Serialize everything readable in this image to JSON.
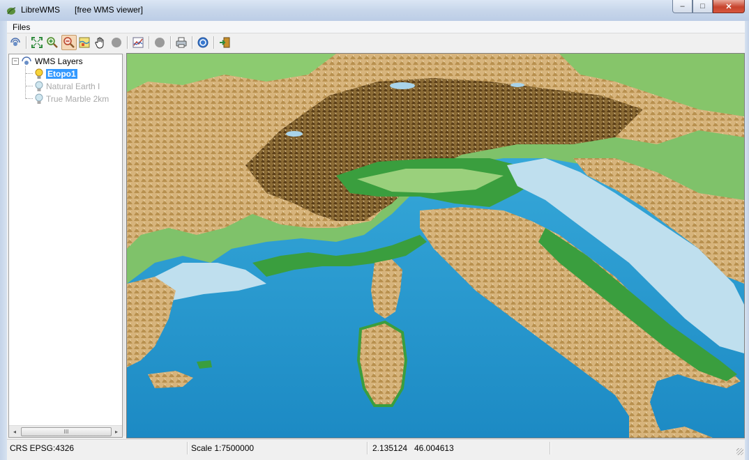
{
  "window": {
    "app_name": "LibreWMS",
    "subtitle": "[free WMS viewer]",
    "minimize_label": "–",
    "maximize_label": "□",
    "close_label": "✕"
  },
  "menu": {
    "files_label": "Files"
  },
  "toolbar": {
    "buttons": [
      "wms-connect",
      "zoom-full-extent",
      "zoom-in",
      "zoom-out",
      "zoom-layer",
      "pan",
      "stop",
      "map-style",
      "stop-2",
      "print",
      "help",
      "exit"
    ],
    "active_button": "zoom-out"
  },
  "tree": {
    "root_label": "WMS Layers",
    "expander": "−",
    "layers": [
      {
        "label": "Etopo1",
        "selected": true,
        "enabled": true
      },
      {
        "label": "Natural Earth I",
        "selected": false,
        "enabled": false
      },
      {
        "label": "True Marble 2km",
        "selected": false,
        "enabled": false
      }
    ],
    "scroll_left": "◂",
    "scroll_right": "▸",
    "scroll_thumb": "III"
  },
  "status": {
    "crs": "CRS EPSG:4326",
    "scale": "Scale 1:7500000",
    "lon": "2.135124",
    "lat": "46.004613"
  },
  "colors": {
    "sea": "#2fa7d8",
    "shallow_sea": "#b9dcec",
    "lowland": "#2f9a3a",
    "plain": "#8cc86a",
    "hills": "#d9b27a",
    "mountains": "#7a5a2c",
    "selection": "#3399ff"
  }
}
